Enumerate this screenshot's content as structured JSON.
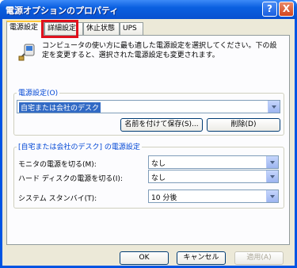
{
  "window": {
    "title": "電源オプションのプロパティ",
    "help": "?",
    "close": "X"
  },
  "tabs": [
    {
      "label": "電源設定"
    },
    {
      "label": "詳細設定"
    },
    {
      "label": "休止状態"
    },
    {
      "label": "UPS"
    }
  ],
  "description": "コンピュータの使い方に最も適した電源設定を選択してください。下の設定を変更すると、選択された電源設定も変更されます。",
  "scheme": {
    "label": "電源設定(O)",
    "selected": "自宅または会社のデスク",
    "save_as": "名前を付けて保存(S)...",
    "delete": "削除(D)"
  },
  "settings": {
    "group_label": "[自宅または会社のデスク] の電源設定",
    "rows": [
      {
        "label": "モニタの電源を切る(M):",
        "value": "なし"
      },
      {
        "label": "ハード ディスクの電源を切る(I):",
        "value": "なし"
      },
      {
        "label": "システム スタンバイ(T):",
        "value": "10 分後"
      }
    ]
  },
  "footer": {
    "ok": "OK",
    "cancel": "キャンセル",
    "apply": "適用(A)"
  },
  "colors": {
    "highlight": "#e0101c",
    "title_bar": "#0a5fe0",
    "group_label": "#0046d5"
  }
}
